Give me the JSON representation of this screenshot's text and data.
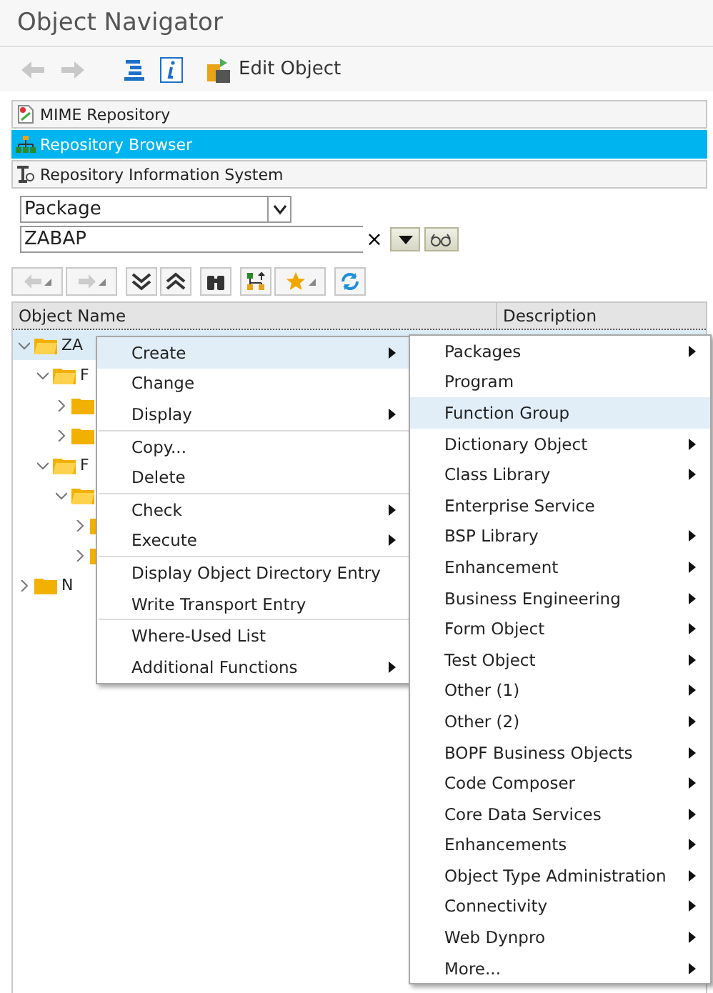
{
  "window": {
    "title": "Object Navigator"
  },
  "toolbar": {
    "back": {
      "disabled": true
    },
    "forward": {
      "disabled": true
    },
    "edit_label": "Edit Object"
  },
  "nav_tabs": [
    {
      "label": "MIME Repository",
      "selected": false
    },
    {
      "label": "Repository Browser",
      "selected": true
    },
    {
      "label": "Repository Information System",
      "selected": false
    }
  ],
  "object_type": {
    "value": "Package"
  },
  "object_name": {
    "value": "ZABAP",
    "clear": "×"
  },
  "table": {
    "columns": [
      "Object Name",
      "Description"
    ]
  },
  "tree": [
    {
      "label": "ZA",
      "expanded": true,
      "selected": true,
      "children": [
        {
          "label": "F",
          "expanded": true,
          "children": [
            {
              "expanded": false
            },
            {
              "expanded": false
            }
          ]
        },
        {
          "label": "F",
          "expanded": true,
          "children": [
            {
              "expanded": true,
              "children": [
                {
                  "expanded": false
                },
                {
                  "expanded": false
                }
              ]
            }
          ]
        }
      ]
    },
    {
      "label": "N",
      "expanded": false
    }
  ],
  "context_menu": {
    "groups": [
      [
        {
          "label": "Create",
          "submenu": true,
          "selected": true
        },
        {
          "label": "Change",
          "submenu": false,
          "selected": false
        },
        {
          "label": "Display",
          "submenu": true,
          "selected": false
        }
      ],
      [
        {
          "label": "Copy...",
          "submenu": false,
          "selected": false
        },
        {
          "label": "Delete",
          "submenu": false,
          "selected": false
        }
      ],
      [
        {
          "label": "Check",
          "submenu": true,
          "selected": false
        },
        {
          "label": "Execute",
          "submenu": true,
          "selected": false
        }
      ],
      [
        {
          "label": "Display Object Directory Entry",
          "submenu": false,
          "selected": false
        },
        {
          "label": "Write Transport Entry",
          "submenu": false,
          "selected": false
        }
      ],
      [
        {
          "label": "Where-Used List",
          "submenu": false,
          "selected": false
        },
        {
          "label": "Additional Functions",
          "submenu": true,
          "selected": false
        }
      ]
    ]
  },
  "submenu": [
    {
      "label": "Packages",
      "submenu": true,
      "selected": false
    },
    {
      "label": "Program",
      "submenu": false,
      "selected": false
    },
    {
      "label": "Function Group",
      "submenu": false,
      "selected": true
    },
    {
      "label": "Dictionary Object",
      "submenu": true,
      "selected": false
    },
    {
      "label": "Class Library",
      "submenu": true,
      "selected": false
    },
    {
      "label": "Enterprise Service",
      "submenu": false,
      "selected": false
    },
    {
      "label": "BSP Library",
      "submenu": true,
      "selected": false
    },
    {
      "label": "Enhancement",
      "submenu": true,
      "selected": false
    },
    {
      "label": "Business Engineering",
      "submenu": true,
      "selected": false
    },
    {
      "label": "Form Object",
      "submenu": true,
      "selected": false
    },
    {
      "label": "Test Object",
      "submenu": true,
      "selected": false
    },
    {
      "label": "Other (1)",
      "submenu": true,
      "selected": false
    },
    {
      "label": "Other (2)",
      "submenu": true,
      "selected": false
    },
    {
      "label": "BOPF Business Objects",
      "submenu": true,
      "selected": false
    },
    {
      "label": "Code Composer",
      "submenu": true,
      "selected": false
    },
    {
      "label": "Core Data Services",
      "submenu": true,
      "selected": false
    },
    {
      "label": "Enhancements",
      "submenu": true,
      "selected": false
    },
    {
      "label": "Object Type Administration",
      "submenu": true,
      "selected": false
    },
    {
      "label": "Connectivity",
      "submenu": true,
      "selected": false
    },
    {
      "label": "Web Dynpro",
      "submenu": true,
      "selected": false
    },
    {
      "label": "More...",
      "submenu": true,
      "selected": false
    }
  ]
}
